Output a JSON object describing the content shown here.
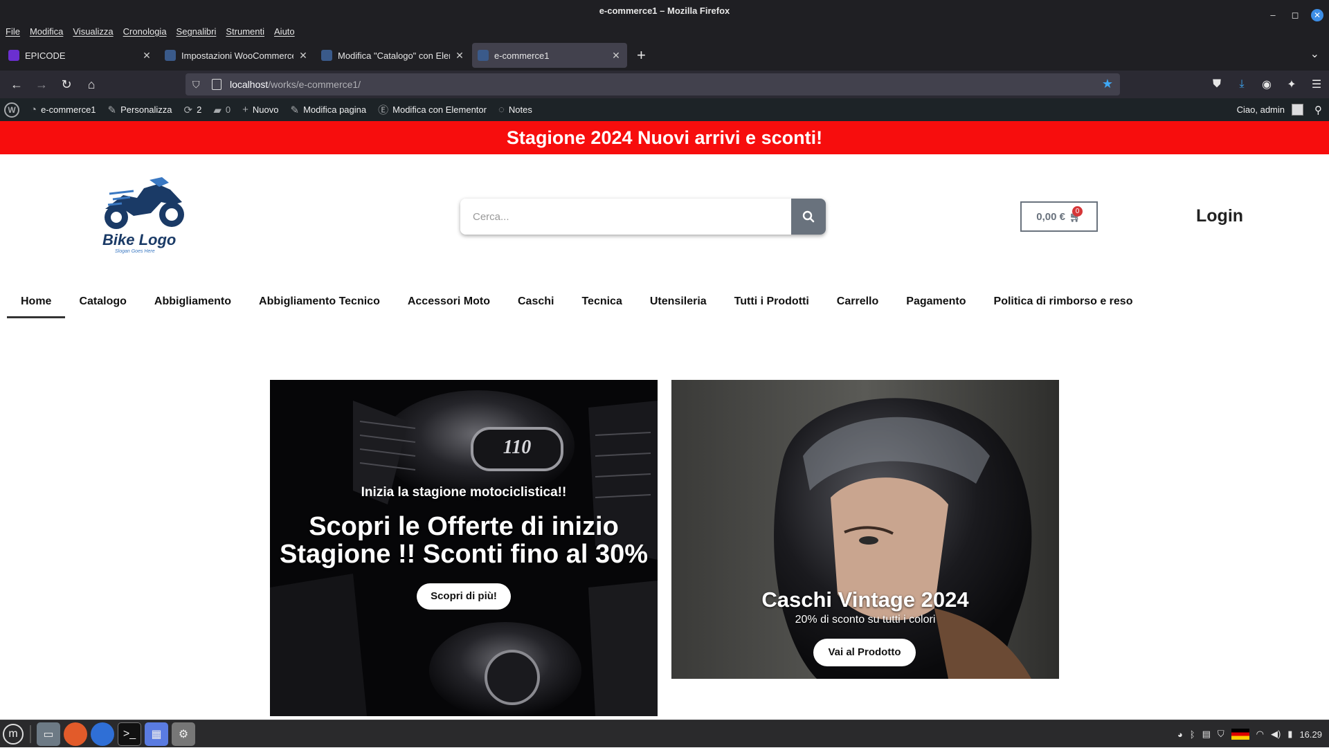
{
  "window": {
    "title": "e-commerce1 – Mozilla Firefox"
  },
  "menubar": [
    "File",
    "Modifica",
    "Visualizza",
    "Cronologia",
    "Segnalibri",
    "Strumenti",
    "Aiuto"
  ],
  "tabs": [
    {
      "title": "EPICODE",
      "icon_color": "#6b2fd0",
      "active": false
    },
    {
      "title": "Impostazioni WooCommerce",
      "icon_color": "#3a5a8a",
      "active": false
    },
    {
      "title": "Modifica \"Catalogo\" con Elementor",
      "icon_color": "#3a5a8a",
      "active": false
    },
    {
      "title": "e-commerce1",
      "icon_color": "#3a5a8a",
      "active": true
    }
  ],
  "urlbar": {
    "host": "localhost",
    "path": "/works/e-commerce1/"
  },
  "wpbar": {
    "site": "e-commerce1",
    "customize": "Personalizza",
    "updates": "2",
    "comments": "0",
    "new": "Nuovo",
    "edit_page": "Modifica pagina",
    "elementor": "Modifica con Elementor",
    "notes": "Notes",
    "greeting": "Ciao, admin"
  },
  "promo": {
    "text": "Stagione 2024 Nuovi arrivi e sconti!"
  },
  "logo": {
    "text": "Bike Logo",
    "slogan": "Slogan Goes Here"
  },
  "search": {
    "placeholder": "Cerca..."
  },
  "cart": {
    "total": "0,00 €",
    "count": "0"
  },
  "login": {
    "label": "Login"
  },
  "nav": [
    "Home",
    "Catalogo",
    "Abbigliamento",
    "Abbigliamento Tecnico",
    "Accessori Moto",
    "Caschi",
    "Tecnica",
    "Utensileria",
    "Tutti i Prodotti",
    "Carrello",
    "Pagamento",
    "Politica di rimborso e reso"
  ],
  "banner1": {
    "engine_badge": "110",
    "subtitle": "Inizia la stagione motociclistica!!",
    "title_line1": "Scopri le Offerte di inizio",
    "title_line2": "Stagione !! Sconti fino al 30%",
    "button": "Scopri di più!"
  },
  "banner2": {
    "title": "Caschi Vintage 2024",
    "subtitle": "20% di sconto su tutti i colori",
    "button": "Vai al Prodotto"
  },
  "tray": {
    "time": "16.29"
  },
  "colors": {
    "promo": "#f70d0d",
    "accent_gray": "#69727d",
    "wpbar": "#1d2327",
    "firefox_blue": "#3fa8f5"
  }
}
